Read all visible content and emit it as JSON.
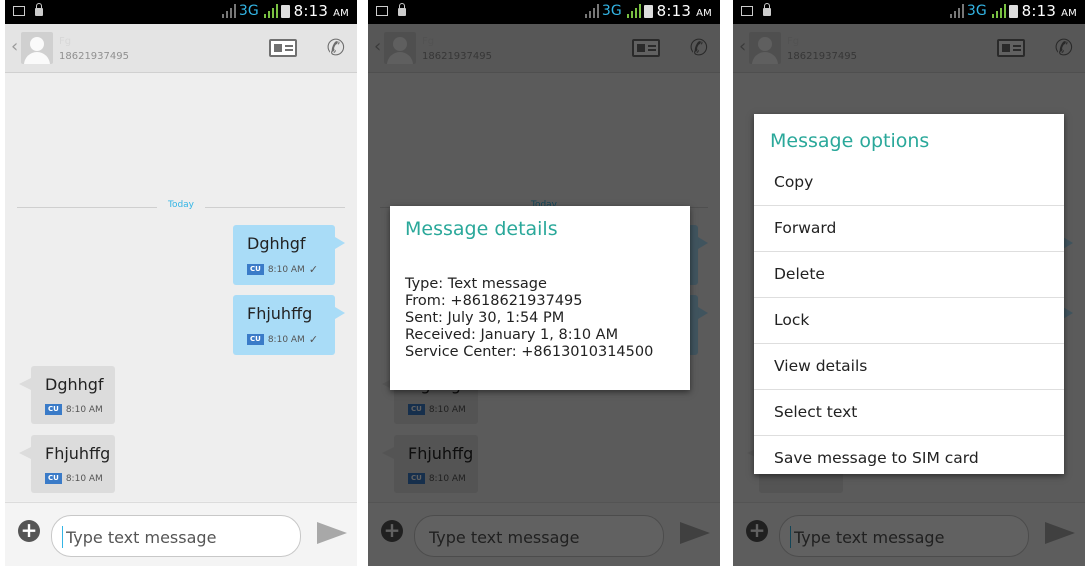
{
  "status": {
    "network": "3G",
    "time": "8:13",
    "ampm": "AM"
  },
  "contact": {
    "name": "Fg",
    "number": "18621937495"
  },
  "conversation": {
    "date_separator": "Today",
    "messages": [
      {
        "direction": "out",
        "text": "Dghhgf",
        "carrier": "CU",
        "time": "8:10 AM"
      },
      {
        "direction": "out",
        "text": "Fhjuhffg",
        "carrier": "CU",
        "time": "8:10 AM"
      },
      {
        "direction": "in",
        "text": "Dghhgf",
        "carrier": "CU",
        "time": "8:10 AM"
      },
      {
        "direction": "in",
        "text": "Fhjuhffg",
        "carrier": "CU",
        "time": "8:10 AM"
      }
    ]
  },
  "composer": {
    "placeholder": "Type text message"
  },
  "details_dialog": {
    "title": "Message details",
    "lines": [
      "Type: Text message",
      "From: +8618621937495",
      "Sent: July 30, 1:54 PM",
      "Received: January 1, 8:10 AM",
      "Service Center: +8613010314500"
    ]
  },
  "options_dialog": {
    "title": "Message options",
    "items": [
      "Copy",
      "Forward",
      "Delete",
      "Lock",
      "View details",
      "Select text",
      "Save message to SIM card"
    ]
  },
  "colors": {
    "accent": "#33b5e5",
    "dialog_title": "#2aa89a",
    "outgoing_bubble": "#a9dcf7",
    "incoming_bubble": "#dcdcdc"
  }
}
